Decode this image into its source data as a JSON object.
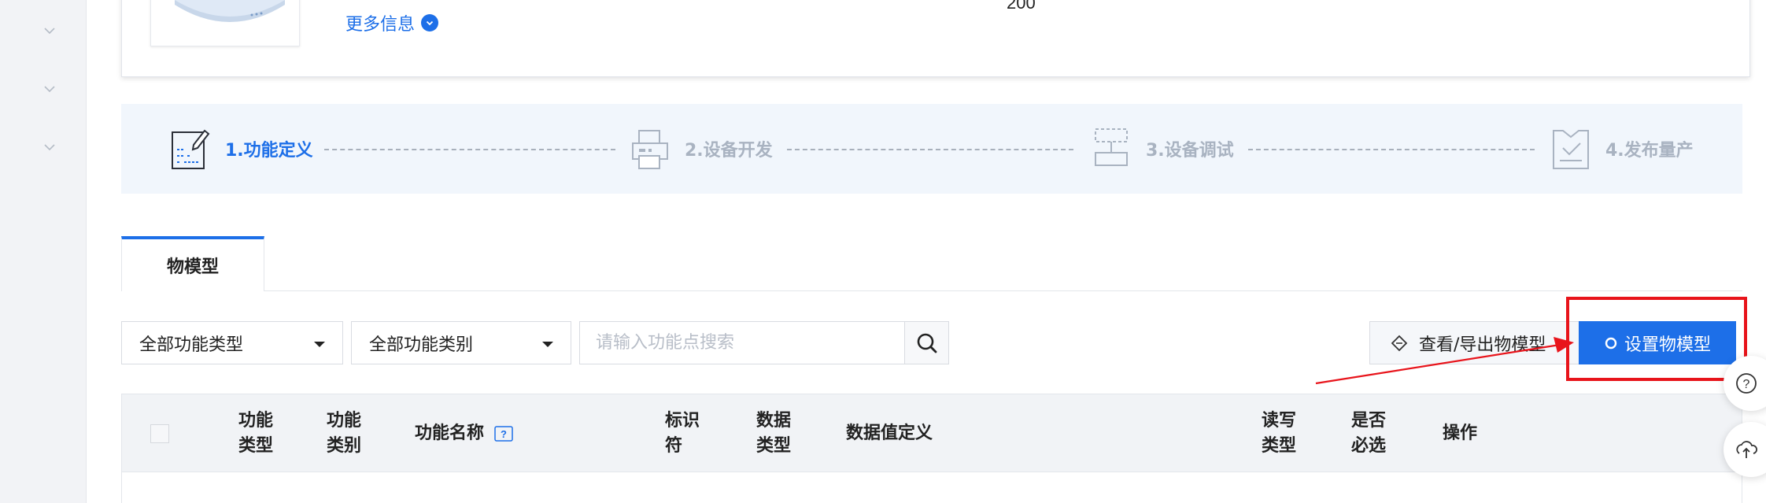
{
  "product": {
    "more_info_label": "更多信息",
    "count_value": "200"
  },
  "stepper": {
    "steps": [
      {
        "label": "1.功能定义",
        "active": true
      },
      {
        "label": "2.设备开发",
        "active": false
      },
      {
        "label": "3.设备调试",
        "active": false
      },
      {
        "label": "4.发布量产",
        "active": false
      }
    ]
  },
  "tabs": [
    {
      "label": "物模型",
      "active": true
    }
  ],
  "filters": {
    "type_select": "全部功能类型",
    "category_select": "全部功能类别",
    "search_placeholder": "请输入功能点搜索"
  },
  "actions": {
    "view_export_label": "查看/导出物模型",
    "set_model_label": "设置物模型"
  },
  "table": {
    "headers": {
      "func_type_1": "功能",
      "func_type_2": "类型",
      "func_category_1": "功能",
      "func_category_2": "类别",
      "func_name": "功能名称",
      "identifier_1": "标识",
      "identifier_2": "符",
      "data_type_1": "数据",
      "data_type_2": "类型",
      "data_def": "数据值定义",
      "rw_type_1": "读写",
      "rw_type_2": "类型",
      "required_1": "是否",
      "required_2": "必选",
      "operation": "操作"
    }
  },
  "colors": {
    "accent": "#1d6fe8",
    "highlight": "#e8141b",
    "inactive_step": "#a9b3c1"
  }
}
